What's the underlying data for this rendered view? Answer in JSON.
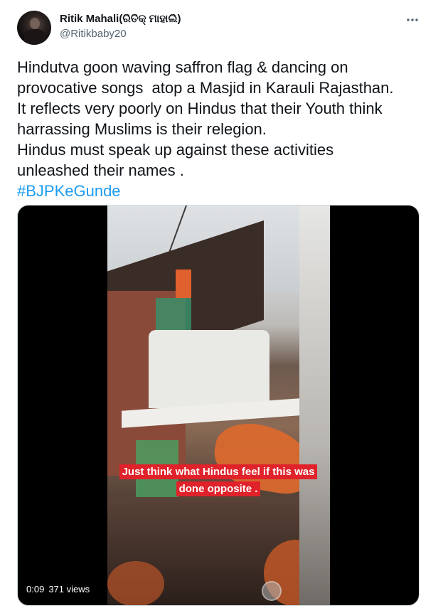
{
  "tweet": {
    "author_name": "Ritik Mahali(ରିତିକ୍ ମାହାଲି)",
    "author_handle": "@Ritikbaby20",
    "body_text": "Hindutva goon waving saffron flag & dancing on\nprovocative songs  atop a Masjid in Karauli Rajasthan.\nIt reflects very poorly on Hindus that their Youth think\nharrassing Muslims is their relegion.\nHindus must speak up against these activities\nunleashed their names .",
    "hashtag": "#BJPKeGunde",
    "more_icon": "more-horizontal-icon"
  },
  "video": {
    "caption": "Just think what Hindus feel if this was done opposite .",
    "elapsed_time": "0:09",
    "views": "371 views"
  },
  "colors": {
    "link": "#1d9bf0",
    "secondary_text": "#536471",
    "caption_bg": "#e0222a"
  }
}
